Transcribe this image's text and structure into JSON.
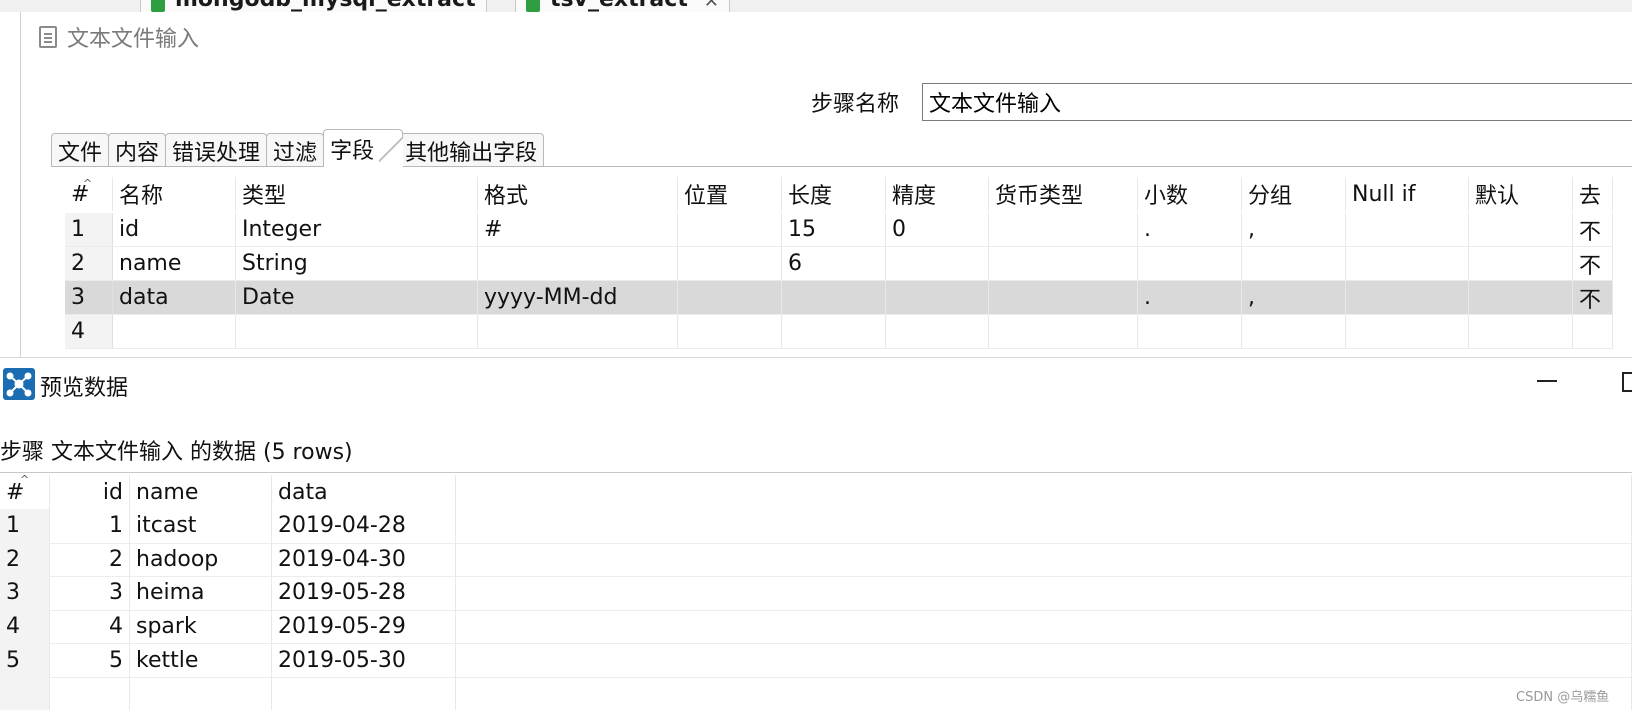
{
  "background_tabs": [
    {
      "label": "mongodb_mysql_extract"
    },
    {
      "label": "tsv_extract"
    }
  ],
  "dialog": {
    "title": "文本文件输入",
    "step_name_label": "步骤名称",
    "step_name_value": "文本文件输入"
  },
  "tabs": [
    {
      "label": "文件"
    },
    {
      "label": "内容"
    },
    {
      "label": "错误处理"
    },
    {
      "label": "过滤"
    },
    {
      "label": "字段",
      "active": true
    },
    {
      "label": "其他输出字段"
    }
  ],
  "fields_table": {
    "columns": [
      "#",
      "名称",
      "类型",
      "格式",
      "位置",
      "长度",
      "精度",
      "货币类型",
      "小数",
      "分组",
      "Null if",
      "默认",
      "去"
    ],
    "rows": [
      [
        "1",
        "id",
        "Integer",
        "#",
        "",
        "15",
        "0",
        "",
        ".",
        ",",
        "",
        "",
        "不"
      ],
      [
        "2",
        "name",
        "String",
        "",
        "",
        "6",
        "",
        "",
        "",
        "",
        "",
        "",
        "不"
      ],
      [
        "3",
        "data",
        "Date",
        "yyyy-MM-dd",
        "",
        "",
        "",
        "",
        ".",
        ",",
        "",
        "",
        "不"
      ],
      [
        "4",
        "",
        "",
        "",
        "",
        "",
        "",
        "",
        "",
        "",
        "",
        "",
        ""
      ]
    ],
    "selected_row": 3
  },
  "preview": {
    "title": "预览数据",
    "caption": "步骤 文本文件输入 的数据  (5 rows)",
    "columns": [
      "#",
      "id",
      "name",
      "data"
    ],
    "rows": [
      [
        "1",
        "1",
        "itcast",
        "2019-04-28"
      ],
      [
        "2",
        "2",
        "hadoop",
        "2019-04-30"
      ],
      [
        "3",
        "3",
        "heima",
        "2019-05-28"
      ],
      [
        "4",
        "4",
        "spark",
        "2019-05-29"
      ],
      [
        "5",
        "5",
        "kettle",
        "2019-05-30"
      ]
    ]
  },
  "watermark": "CSDN @乌糯鱼",
  "colors": {
    "selected_row": "#d9d9d9",
    "rownum_bg": "#f3f3f3",
    "tab_icon": "#2e9e41",
    "preview_icon": "#1a6cb3"
  },
  "icons": {
    "dialog": "document-icon",
    "preview": "network-icon",
    "background_tab": "job-icon"
  }
}
